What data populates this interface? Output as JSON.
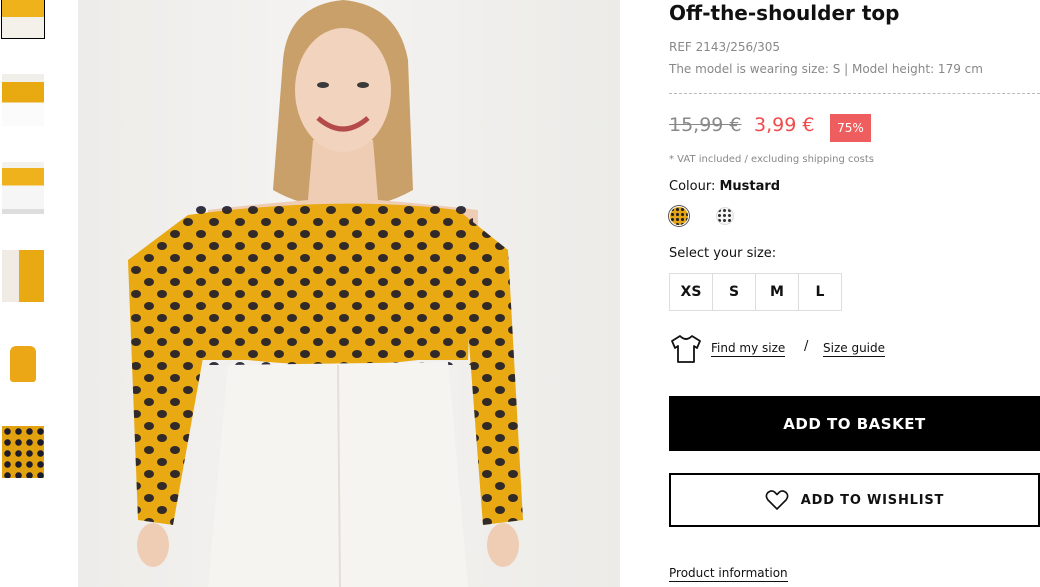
{
  "product": {
    "title": "Off-the-shoulder top",
    "ref": "REF 2143/256/305",
    "model_info": "The model is wearing size: S | Model height: 179 cm",
    "price_old": "15,99 €",
    "price_new": "3,99 €",
    "discount": "75%",
    "vat_note": "* VAT included / excluding shipping costs",
    "colour_label": "Colour:",
    "colour_value": "Mustard"
  },
  "colors": {
    "accent_red": "#f04a4a",
    "badge_red": "#ef5e5e",
    "mustard": "#e6a514"
  },
  "swatches": [
    {
      "name": "mustard-polka-dot",
      "selected": true
    },
    {
      "name": "white-polka-dot",
      "selected": false
    }
  ],
  "sizes": {
    "label": "Select your size:",
    "options": [
      "XS",
      "S",
      "M",
      "L"
    ]
  },
  "size_help": {
    "find_my_size": "Find my size",
    "separator": "/",
    "size_guide": "Size guide",
    "icon": "t-shirt-icon"
  },
  "actions": {
    "add_to_basket": "ADD TO BASKET",
    "add_to_wishlist": "ADD TO WISHLIST",
    "wishlist_icon": "heart-icon"
  },
  "product_information": "Product information",
  "thumbnails": [
    {
      "name": "model-front-closeup",
      "active": true
    },
    {
      "name": "model-full-front"
    },
    {
      "name": "model-full-side"
    },
    {
      "name": "model-portrait"
    },
    {
      "name": "product-flat"
    },
    {
      "name": "fabric-detail"
    }
  ]
}
